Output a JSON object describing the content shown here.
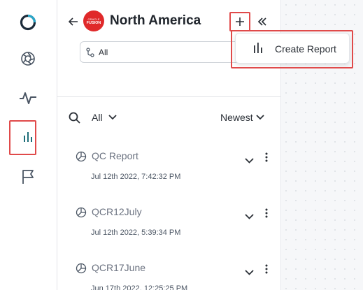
{
  "header": {
    "title": "North America",
    "logo_line1": "ORACLE",
    "logo_line2": "FUSION"
  },
  "filter": {
    "value": "All"
  },
  "toolbar": {
    "scope": "All",
    "sort": "Newest"
  },
  "popup": {
    "create_report_label": "Create Report"
  },
  "reports": [
    {
      "name": "QC Report",
      "date": "Jul 12th 2022, 7:42:32 PM"
    },
    {
      "name": "QCR12July",
      "date": "Jul 12th 2022, 5:39:34 PM"
    },
    {
      "name": "QCR17June",
      "date": "Jun 17th 2022, 12:25:25 PM"
    }
  ],
  "rail": {
    "icons": [
      "app-logo-icon",
      "aperture-icon",
      "activity-icon",
      "reports-icon",
      "flag-icon"
    ]
  },
  "colors": {
    "accent": "#1f6f7a",
    "highlight": "#e04a4a",
    "brand": "#e0292a"
  }
}
